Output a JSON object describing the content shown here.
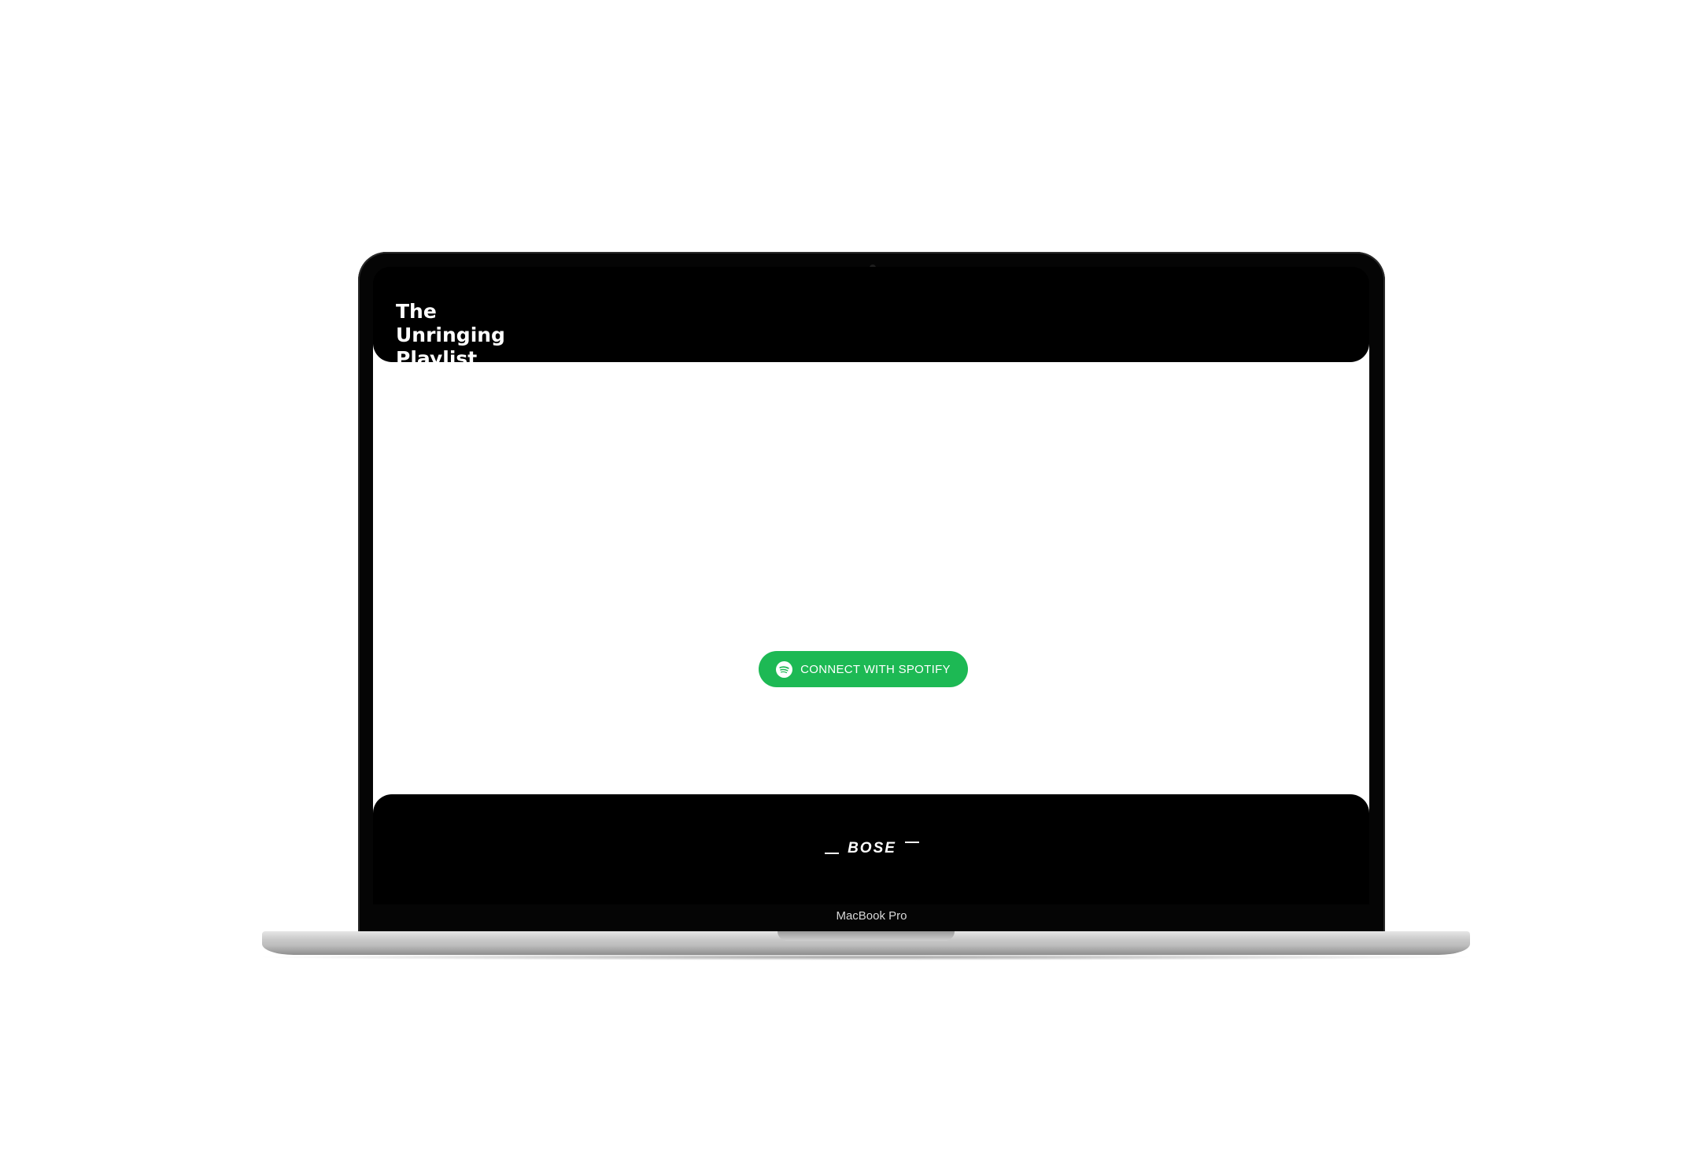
{
  "site": {
    "title": "The\nUnringing\nPlaylist",
    "connect_button_label": "CONNECT WITH SPOTIFY",
    "footer_logo": "BOSE"
  },
  "device": {
    "label": "MacBook Pro"
  },
  "colors": {
    "spotify_green": "#1db954",
    "header_bg": "#000000",
    "main_bg": "#ffffff"
  },
  "icons": {
    "connect_button_icon": "spotify-icon",
    "footer_logo_icon": "bose-logo"
  }
}
